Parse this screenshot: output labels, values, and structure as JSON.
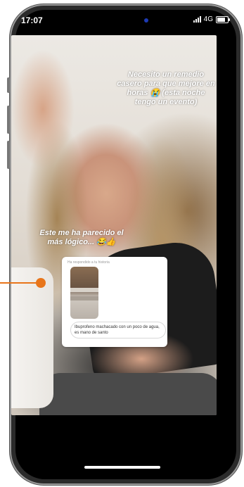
{
  "status_bar": {
    "time": "17:07",
    "network": "4G"
  },
  "story": {
    "caption_top": "Necesito un remedio casero para que mejore en horas 😭 (esta noche tengo un evento)",
    "caption_middle": "Este me ha parecido el más lógico... 😂👍"
  },
  "reply_card": {
    "header": "Ha respondido a tu historia",
    "message": "Ibuprofeno machacado con un poco de agua, es mano de santo"
  },
  "colors": {
    "pointer": "#e8751a",
    "phone_frame": "#2b2b2b",
    "camera_dot": "#1d3ab3"
  }
}
